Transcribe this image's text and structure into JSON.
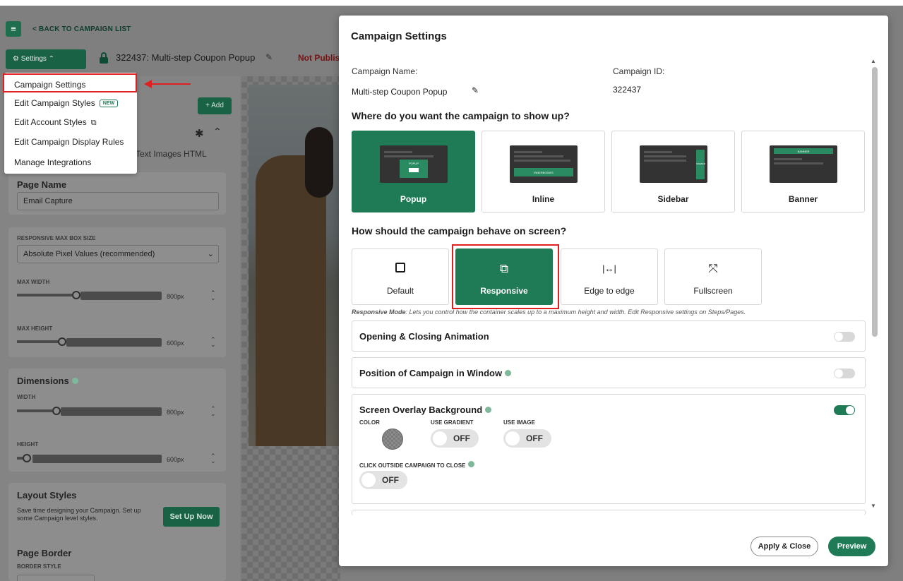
{
  "topbar": {
    "back_label": "< BACK TO CAMPAIGN LIST",
    "settings_label": "⚙ Settings ⌃",
    "campaign_title": "322437: Multi-step Coupon Popup",
    "status": "Not Publish"
  },
  "dropdown": {
    "items": [
      {
        "label": "Campaign Settings"
      },
      {
        "label": "Edit Campaign Styles",
        "badge": "NEW"
      },
      {
        "label": "Edit Account Styles"
      },
      {
        "label": "Edit Campaign Display Rules"
      },
      {
        "label": "Manage Integrations"
      }
    ]
  },
  "left": {
    "add_label": "+ Add",
    "tabs_fragment": "Text   Images   HTML",
    "page_name": {
      "title": "Page Name",
      "value": "Email Capture"
    },
    "responsive": {
      "label": "RESPONSIVE MAX BOX SIZE",
      "select_value": "Absolute Pixel Values (recommended)",
      "max_width_label": "MAX WIDTH",
      "max_width_value": "800px",
      "max_height_label": "MAX HEIGHT",
      "max_height_value": "600px"
    },
    "dimensions": {
      "title": "Dimensions",
      "width_label": "WIDTH",
      "width_value": "800px",
      "height_label": "HEIGHT",
      "height_value": "600px"
    },
    "layout_styles": {
      "title": "Layout Styles",
      "desc": "Save time designing your Campaign. Set up some Campaign level styles.",
      "button": "Set Up Now"
    },
    "page_border": {
      "title": "Page Border",
      "label": "BORDER STYLE"
    }
  },
  "modal": {
    "title": "Campaign Settings",
    "name_label": "Campaign Name:",
    "name_value": "Multi-step Coupon Popup",
    "id_label": "Campaign ID:",
    "id_value": "322437",
    "where_heading": "Where do you want the campaign to show up?",
    "placements": [
      {
        "label": "Popup",
        "selected": true
      },
      {
        "label": "Inline",
        "selected": false
      },
      {
        "label": "Sidebar",
        "selected": false
      },
      {
        "label": "Banner",
        "selected": false
      }
    ],
    "behave_heading": "How should the campaign behave on screen?",
    "behaviors": [
      {
        "label": "Default",
        "icon": "square-icon",
        "selected": false
      },
      {
        "label": "Responsive",
        "icon": "external-link-icon",
        "selected": true
      },
      {
        "label": "Edge to edge",
        "icon": "horizontal-arrows-icon",
        "selected": false
      },
      {
        "label": "Fullscreen",
        "icon": "expand-icon",
        "selected": false
      }
    ],
    "responsive_note_bold": "Responsive Mode",
    "responsive_note": ": Lets you control how the container scales up to a maximum height and width. Edit Responsive settings on Steps/Pages.",
    "sections": {
      "animation": "Opening & Closing Animation",
      "position": "Position of Campaign in Window",
      "overlay": "Screen Overlay Background"
    },
    "overlay": {
      "color_label": "COLOR",
      "gradient_label": "USE GRADIENT",
      "gradient_value": "OFF",
      "image_label": "USE IMAGE",
      "image_value": "OFF",
      "click_outside_label": "CLICK OUTSIDE CAMPAIGN TO CLOSE",
      "click_outside_value": "OFF"
    },
    "apply_label": "Apply & Close",
    "preview_label": "Preview"
  },
  "thumb_text": {
    "popup": "POPUP",
    "inline": "INNERBODIES",
    "sidebar": "SIDEBAR",
    "banner": "BANNER"
  },
  "colors": {
    "accent": "#1f7a56",
    "highlight": "#e02020"
  }
}
